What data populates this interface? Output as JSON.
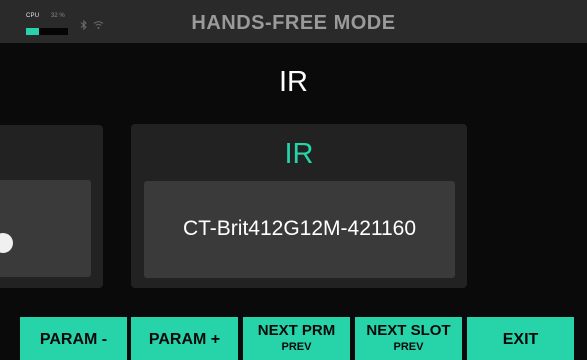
{
  "status_bar": {
    "cpu_label": "CPU",
    "cpu_percent_text": "32 %",
    "cpu_fraction": 0.32,
    "bluetooth_icon": "bluetooth-icon",
    "wifi_icon": "wifi-icon"
  },
  "header": {
    "title": "HANDS-FREE MODE"
  },
  "block": {
    "title": "IR"
  },
  "main_card": {
    "category": "IR",
    "value": "CT-Brit412G12M-421160"
  },
  "footswitches": [
    {
      "label": "PARAM -",
      "sub": ""
    },
    {
      "label": "PARAM +",
      "sub": ""
    },
    {
      "label": "NEXT PRM",
      "sub": "PREV"
    },
    {
      "label": "NEXT SLOT",
      "sub": "PREV"
    },
    {
      "label": "EXIT",
      "sub": ""
    }
  ],
  "colors": {
    "accent": "#27d3a8",
    "background": "#0a0a0a",
    "top_bar": "#2a2a2a",
    "card": "#222222",
    "card_inner": "#3a3a3a"
  }
}
